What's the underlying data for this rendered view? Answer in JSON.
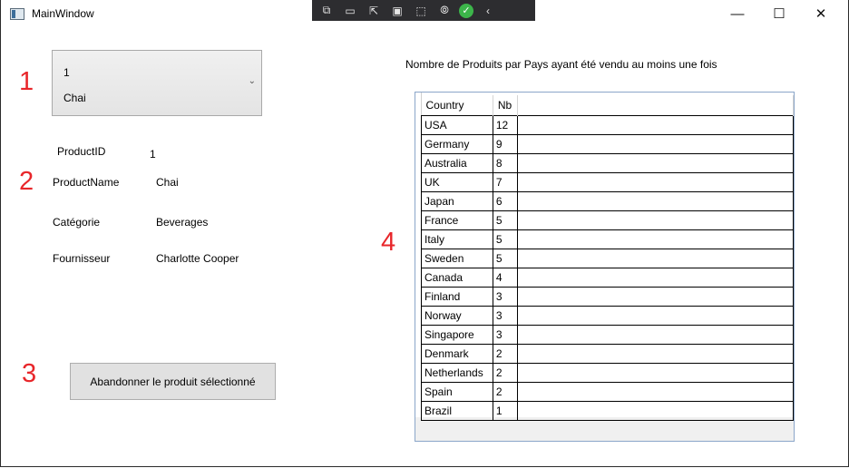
{
  "window": {
    "title": "MainWindow",
    "minimize": "—",
    "maximize": "☐",
    "close": "✕"
  },
  "debug_toolbar": {
    "icons": [
      "live-visual-tree-icon",
      "display-layout-icon",
      "select-element-icon",
      "preview-selection-icon",
      "track-focus-icon",
      "binding-failures-icon",
      "hot-reload-ok-icon",
      "collapse-icon"
    ]
  },
  "markers": [
    "1",
    "2",
    "3",
    "4"
  ],
  "combo": {
    "line1": "1",
    "line2": "Chai"
  },
  "details": {
    "product_id_label": "ProductID",
    "product_id_value": "1",
    "product_name_label": "ProductName",
    "product_name_value": "Chai",
    "category_label": "Catégorie",
    "category_value": "Beverages",
    "supplier_label": "Fournisseur",
    "supplier_value": "Charlotte Cooper"
  },
  "button": {
    "label": "Abandonner le produit sélectionné"
  },
  "grid": {
    "title": "Nombre de Produits par Pays ayant été vendu au moins une fois",
    "headers": [
      "Country",
      "Nb"
    ],
    "rows": [
      [
        "USA",
        "12"
      ],
      [
        "Germany",
        "9"
      ],
      [
        "Australia",
        "8"
      ],
      [
        "UK",
        "7"
      ],
      [
        "Japan",
        "6"
      ],
      [
        "France",
        "5"
      ],
      [
        "Italy",
        "5"
      ],
      [
        "Sweden",
        "5"
      ],
      [
        "Canada",
        "4"
      ],
      [
        "Finland",
        "3"
      ],
      [
        "Norway",
        "3"
      ],
      [
        "Singapore",
        "3"
      ],
      [
        "Denmark",
        "2"
      ],
      [
        "Netherlands",
        "2"
      ],
      [
        "Spain",
        "2"
      ],
      [
        "Brazil",
        "1"
      ]
    ]
  }
}
